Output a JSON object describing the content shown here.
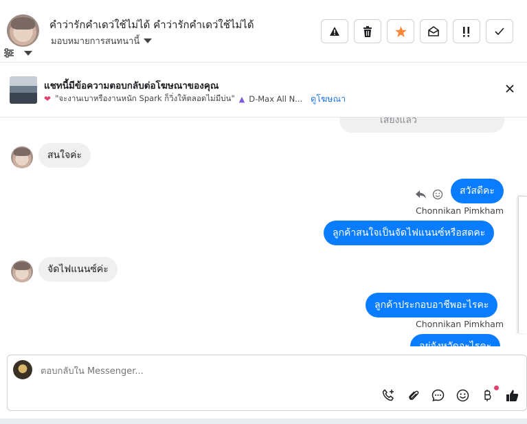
{
  "header": {
    "title": "คำว่ารักคำเดว่ใช้ไม่ได้ คำว่ารักคำเดว่ใช้ไม่ได้",
    "assign_label": "มอบหมายการสนทนานี้",
    "tools": [
      {
        "icon": "warning-icon",
        "label": "Report"
      },
      {
        "icon": "trash-icon",
        "label": "Delete"
      },
      {
        "icon": "star-icon",
        "label": "Star",
        "color": "#f5873b"
      },
      {
        "icon": "envelope-open-icon",
        "label": "Mark unread"
      },
      {
        "icon": "priority-icon",
        "label": "Follow up"
      },
      {
        "icon": "check-icon",
        "label": "Done"
      }
    ]
  },
  "banner": {
    "title": "แชทนี้มีข้อความตอบกลับต่อโฆษณาของคุณ",
    "ad_text": "\"จะงานเบาหรืองานหนัก Spark ก็วิ่งให้ตลอดไม่มีบ่น\"",
    "ad_text_2": "D-Max All N...",
    "view_ad_label": "ดูโฆษณา"
  },
  "messages": [
    {
      "direction": "out",
      "text": "เสียงแล้ว",
      "partial": true
    },
    {
      "direction": "in",
      "text": "สนใจค่ะ"
    },
    {
      "direction": "out",
      "text": "สวัสดีคะ"
    },
    {
      "direction": "out",
      "sender": "Chonnikan Pimkham",
      "text": "ลูกค้าสนใจเป็นจัดไฟแนนซ์หรือสดคะ"
    },
    {
      "direction": "in",
      "text": "จัดไฟแนนซ์ค่ะ"
    },
    {
      "direction": "out",
      "text": "ลูกค้าประกอบอาชีพอะไรคะ"
    },
    {
      "direction": "out",
      "sender": "Chonnikan Pimkham",
      "text": "อยู่จังหวัดอะไรคะ",
      "partial": true
    }
  ],
  "composer": {
    "placeholder": "ตอบกลับใน Messenger...",
    "tools": [
      "call-add-icon",
      "paperclip-icon",
      "chat-bubble-icon",
      "emoji-icon",
      "baht-icon",
      "thumbs-up-icon"
    ]
  },
  "colors": {
    "outgoing_bubble": "#0a7cff",
    "incoming_bubble": "#f0f0f0",
    "link": "#1a73e8",
    "star": "#f5873b"
  }
}
